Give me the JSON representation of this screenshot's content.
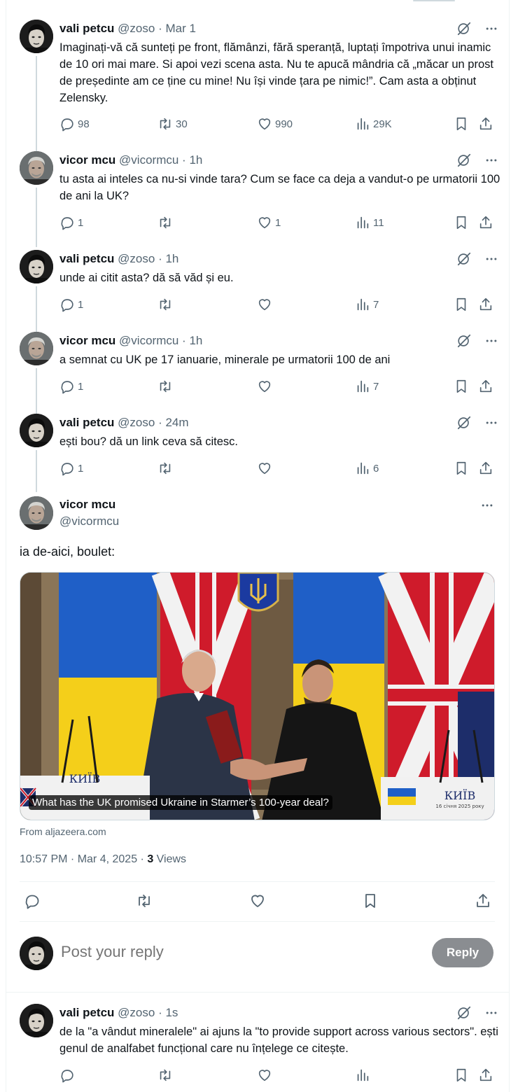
{
  "thread": [
    {
      "name": "vali petcu",
      "handle": "@zoso",
      "dot": "·",
      "time": "Mar 1",
      "text": "Imaginați-vă că sunteți pe front, flămânzi, fără speranță, luptați împotriva unui inamic de 10 ori mai mare. Si apoi vezi scena asta. Nu te apucă mândria că „măcar un prost de președinte am ce ține cu mine! Nu își vinde țara pe nimic!”. Cam asta a obținut Zelensky.",
      "replies": "98",
      "reposts": "30",
      "likes": "990",
      "views": "29K"
    },
    {
      "name": "vicor mcu",
      "handle": "@vicormcu",
      "dot": "·",
      "time": "1h",
      "text": "tu asta ai inteles ca nu-si vinde tara? Cum se face ca deja a vandut-o pe urmatorii 100 de ani la UK?",
      "replies": "1",
      "reposts": "",
      "likes": "1",
      "views": "11"
    },
    {
      "name": "vali petcu",
      "handle": "@zoso",
      "dot": "·",
      "time": "1h",
      "text": "unde ai citit asta? dă să văd și eu.",
      "replies": "1",
      "reposts": "",
      "likes": "",
      "views": "7"
    },
    {
      "name": "vicor mcu",
      "handle": "@vicormcu",
      "dot": "·",
      "time": "1h",
      "text": "a semnat cu UK pe 17 ianuarie, minerale pe urmatorii 100 de ani",
      "replies": "1",
      "reposts": "",
      "likes": "",
      "views": "7"
    },
    {
      "name": "vali petcu",
      "handle": "@zoso",
      "dot": "·",
      "time": "24m",
      "text": "ești bou? dă un link ceva să citesc.",
      "replies": "1",
      "reposts": "",
      "likes": "",
      "views": "6"
    }
  ],
  "main": {
    "name": "vicor mcu",
    "handle": "@vicormcu",
    "text": "ia de-aici, boulet:",
    "card_title": "What has the UK promised Ukraine in Starmer’s 100-year deal?",
    "card_source": "From aljazeera.com",
    "card_podium_left": "КИЇВ",
    "card_podium_right": "КИЇВ",
    "card_podium_date": "16 січня 2025 року",
    "time": "10:57 PM · Mar 4, 2025 · ",
    "views_count": "3",
    "views_label": " Views"
  },
  "reply_box": {
    "placeholder": "Post your reply",
    "button": "Reply"
  },
  "last_reply": {
    "name": "vali petcu",
    "handle": "@zoso",
    "dot": "·",
    "time": "1s",
    "text": "de la \"a vândut mineralele\" ai ajuns la \"to provide support across various sectors\". ești genul de analfabet funcțional care nu înțelege ce citește.",
    "replies": "",
    "reposts": "",
    "likes": "",
    "views": ""
  },
  "colors": {
    "text": "#0f1419",
    "secondary": "#536471",
    "border": "#eff3f4",
    "reply_button": "#8a8d91"
  },
  "icons": [
    "reply-icon",
    "repost-icon",
    "like-icon",
    "views-icon",
    "bookmark-icon",
    "share-icon",
    "grok-icon",
    "more-icon"
  ]
}
